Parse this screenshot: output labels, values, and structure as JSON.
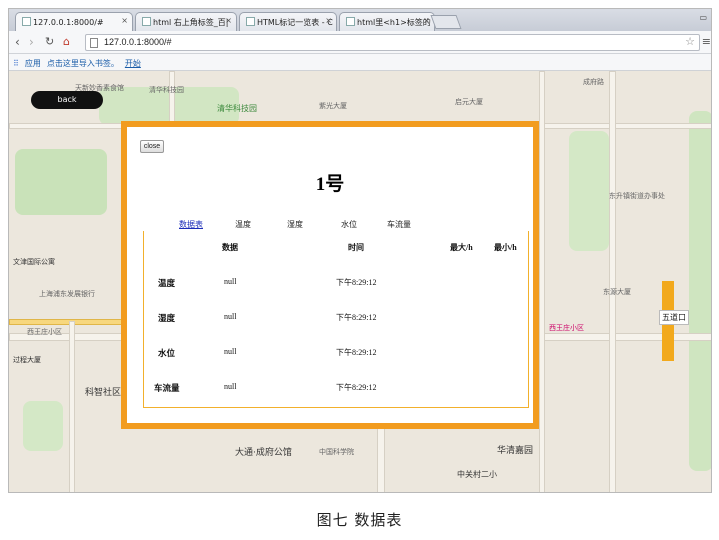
{
  "browser": {
    "tabs": [
      {
        "label": "127.0.0.1:8000/#",
        "active": true
      },
      {
        "label": "html 右上角标签_百|"
      },
      {
        "label": "HTML标记一览表 - C"
      },
      {
        "label": "html里<h1>标签的"
      }
    ],
    "address": "127.0.0.1:8000/#",
    "bookmarks_apps": "应用",
    "bookmarks_hint": "点击这里导入书签。",
    "bookmarks_start": "开始"
  },
  "map": {
    "back_label": "back",
    "labels": [
      "天新妙香素食馆",
      "清华科技园",
      "清华科技园",
      "文津国际公寓",
      "上海浦东发展银行",
      "过程大厦",
      "科智社区",
      "大通·成府公馆",
      "华清嘉园",
      "中关村二小",
      "五道口",
      "东源大厦",
      "成府路",
      "西王庄小区",
      "东升镇街道办事处",
      "启元大厦",
      "紫光大厦",
      "中国科学院"
    ],
    "metro_station": "五道口"
  },
  "modal": {
    "close_label": "close",
    "title": "1号",
    "tabs": [
      {
        "label": "数据表",
        "selected": true
      },
      {
        "label": "温度"
      },
      {
        "label": "湿度"
      },
      {
        "label": "水位"
      },
      {
        "label": "车流量"
      }
    ],
    "table": {
      "headers": [
        "数据",
        "时间",
        "最大/h",
        "最小/h"
      ],
      "rows": [
        {
          "label": "温度",
          "value": "null",
          "time": "下午8:29:12"
        },
        {
          "label": "湿度",
          "value": "null",
          "time": "下午8:29:12"
        },
        {
          "label": "水位",
          "value": "null",
          "time": "下午8:29:12"
        },
        {
          "label": "车流量",
          "value": "null",
          "time": "下午8:29:12"
        }
      ]
    }
  },
  "caption": "图七  数据表",
  "colors": {
    "modal_border": "#f29c1f",
    "selected_tab": "#1a2bb8"
  }
}
